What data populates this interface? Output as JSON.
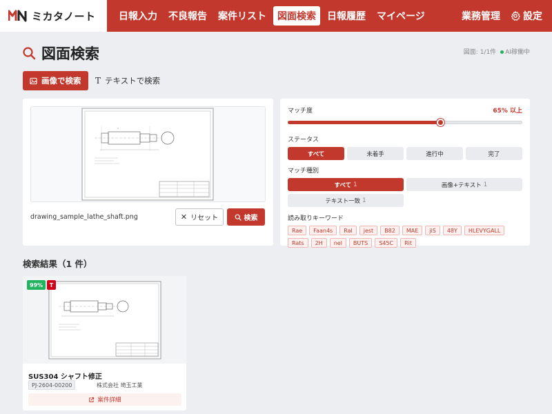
{
  "header": {
    "brand": "ミカタノート",
    "nav": [
      {
        "label": "日報入力",
        "active": false
      },
      {
        "label": "不良報告",
        "active": false
      },
      {
        "label": "案件リスト",
        "active": false
      },
      {
        "label": "図面検索",
        "active": true
      },
      {
        "label": "日報履歴",
        "active": false
      },
      {
        "label": "マイページ",
        "active": false
      }
    ],
    "admin_label": "業務管理",
    "settings_label": "設定",
    "accent_color": "#c2382c"
  },
  "page": {
    "title": "図面検索",
    "meta_count": "図面: 1/1件",
    "meta_ai": "AI稼働中"
  },
  "mode_tabs": {
    "image_label": "画像で検索",
    "text_label": "テキストで検索",
    "active": "image"
  },
  "upload": {
    "filename": "drawing_sample_lathe_shaft.png",
    "reset_label": "リセット",
    "search_label": "検索"
  },
  "filters": {
    "match_label": "マッチ度",
    "match_value": "65% 以上",
    "match_threshold": 0.65,
    "status_label": "ステータス",
    "status_options": [
      "すべて",
      "未着手",
      "進行中",
      "完了"
    ],
    "status_selected": "すべて",
    "match_type_label": "マッチ種別",
    "match_types": [
      {
        "label": "すべて",
        "count": "1",
        "selected": true
      },
      {
        "label": "画像+テキスト",
        "count": "1",
        "selected": false
      },
      {
        "label": "テキスト一致",
        "count": "1",
        "selected": false
      }
    ],
    "keywords_label": "読み取りキーワード",
    "keywords": [
      "Rae",
      "Faan4s",
      "Ral",
      "jest",
      "B82",
      "MAE",
      "jiS",
      "48Y",
      "HLEVYGALL",
      "Rats",
      "2H",
      "nel",
      "BUTS",
      "S45C",
      "Rit"
    ]
  },
  "results": {
    "title": "検索結果（1 件）",
    "items": [
      {
        "score": "99%",
        "type_badge": "T",
        "title": "SUS304 シャフト修正",
        "code": "PJ-2604-00200",
        "company": "株式会社 埼玉工業",
        "detail_label": "案件詳細"
      }
    ]
  }
}
